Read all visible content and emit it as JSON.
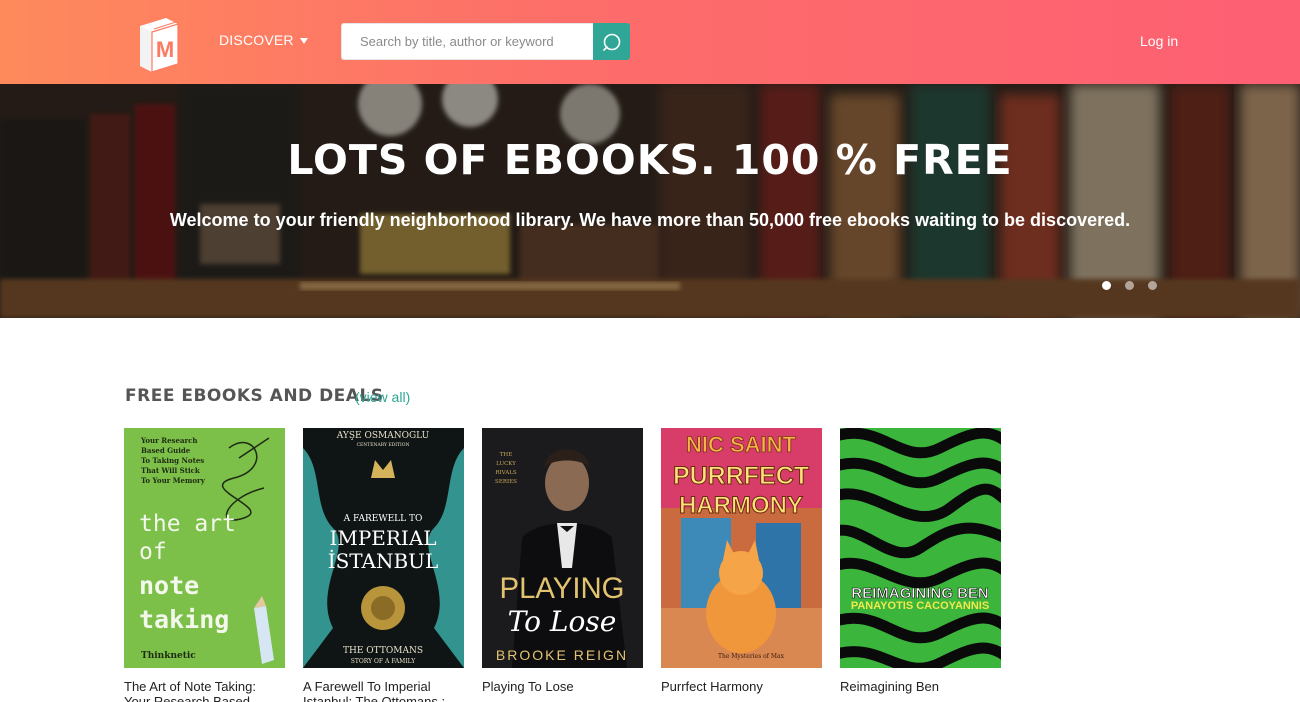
{
  "header": {
    "logo_letter": "M",
    "discover_label": "DISCOVER",
    "search_placeholder": "Search by title, author or keyword",
    "login_label": "Log in"
  },
  "hero": {
    "title": "LOTS OF EBOOKS. 100 % FREE",
    "subtitle": "Welcome to your friendly neighborhood library. We have more than 50,000 free ebooks waiting to be discovered.",
    "slides": 3,
    "active_slide": 1
  },
  "section": {
    "title": "FREE EBOOKS AND DEALS",
    "view_all": "(view all)"
  },
  "books": [
    {
      "title": "The Art of Note Taking: Your Research Based",
      "cover": {
        "tagline": [
          "Your Research",
          "Based Guide",
          "To Taking Notes",
          "That Will Stick",
          "To Your Memory"
        ],
        "line1": "the art",
        "line2": "of",
        "line3": "note",
        "line4": "taking",
        "author": "Thinknetic"
      }
    },
    {
      "title": "A Farewell To Imperial Istanbul: The Ottomans :",
      "cover": {
        "author": "AYŞE OSMANOGLU",
        "edition": "CENTENARY EDITION",
        "line1": "A FAREWELL TO",
        "line2": "IMPERIAL",
        "line3": "İSTANBUL",
        "bottom1": "THE OTTOMANS",
        "bottom2": "STORY OF A FAMILY"
      }
    },
    {
      "title": "Playing To Lose",
      "cover": {
        "series": [
          "THE",
          "LUCKY",
          "RIVALS",
          "SERIES"
        ],
        "line1": "PLAYING",
        "line2": "To Lose",
        "author": "BROOKE REIGN"
      }
    },
    {
      "title": "Purrfect Harmony",
      "cover": {
        "author": "NIC SAINT",
        "line1": "PURRFECT",
        "line2": "HARMONY",
        "series": "The Mysteries of Max"
      }
    },
    {
      "title": "Reimagining Ben",
      "cover": {
        "line1": "REIMAGINING BEN",
        "author": "PANAYOTIS CACOYANNIS"
      }
    }
  ],
  "colors": {
    "header_start": "#fe8a5c",
    "header_end": "#fd5f73",
    "accent_teal": "#2fa696"
  }
}
